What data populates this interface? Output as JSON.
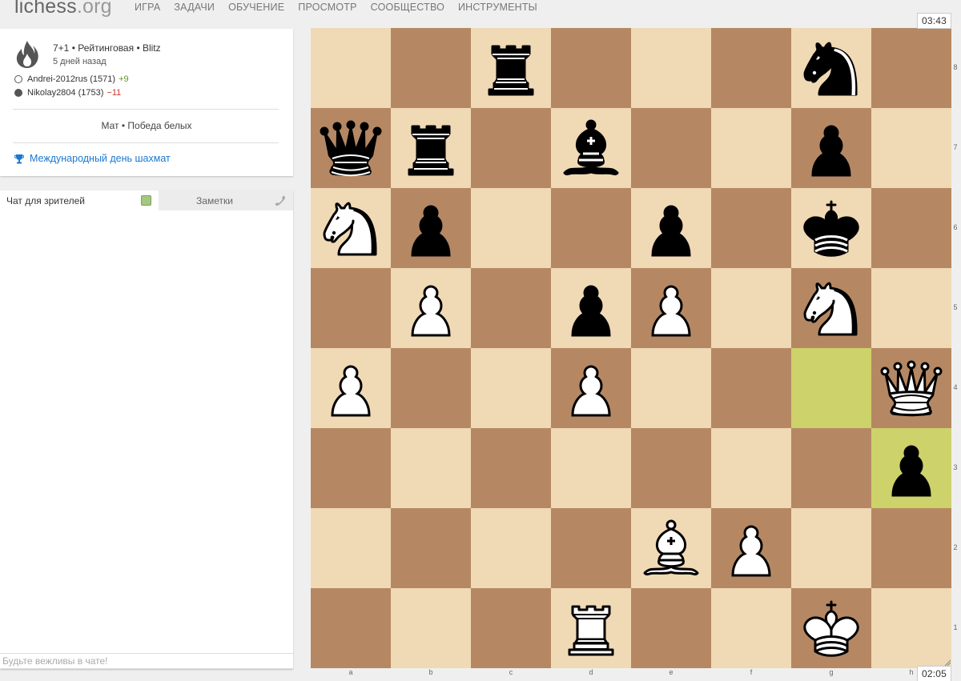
{
  "nav": {
    "logo_main": "lichess",
    "logo_tld": ".org",
    "items": [
      "ИГРА",
      "ЗАДАЧИ",
      "ОБУЧЕНИЕ",
      "ПРОСМОТР",
      "СООБЩЕСТВО",
      "ИНСТРУМЕНТЫ"
    ]
  },
  "game": {
    "type": "7+1 • Рейтинговая • Blitz",
    "date": "5 дней назад",
    "white": {
      "name": "Andrei-2012rus (1571)",
      "diff": "+9"
    },
    "black": {
      "name": "Nikolay2804 (1753)",
      "diff": "−11"
    },
    "result": "Мат • Победа белых",
    "tournament": "Международный день шахмат",
    "icon": "fire-icon"
  },
  "chat": {
    "tab_chat": "Чат для зрителей",
    "tab_notes": "Заметки",
    "placeholder": "Будьте вежливы в чате!"
  },
  "clocks": {
    "top": "03:43",
    "bottom": "02:05"
  },
  "board": {
    "files": [
      "a",
      "b",
      "c",
      "d",
      "e",
      "f",
      "g",
      "h"
    ],
    "ranks": [
      "8",
      "7",
      "6",
      "5",
      "4",
      "3",
      "2",
      "1"
    ],
    "highlight": [
      "g4",
      "h3"
    ],
    "pieces": {
      "c8": "bR",
      "g8": "bN",
      "a7": "bQ",
      "b7": "bR",
      "d7": "bB",
      "g7": "bP",
      "a6": "wN",
      "b6": "bP",
      "e6": "bP",
      "g6": "bK",
      "b5": "wP",
      "d5": "bP",
      "e5": "wP",
      "g5": "wN",
      "a4": "wP",
      "d4": "wP",
      "h4": "wQ",
      "h3": "bP",
      "e2": "wB",
      "f2": "wP",
      "d1": "wR",
      "g1": "wK"
    }
  }
}
